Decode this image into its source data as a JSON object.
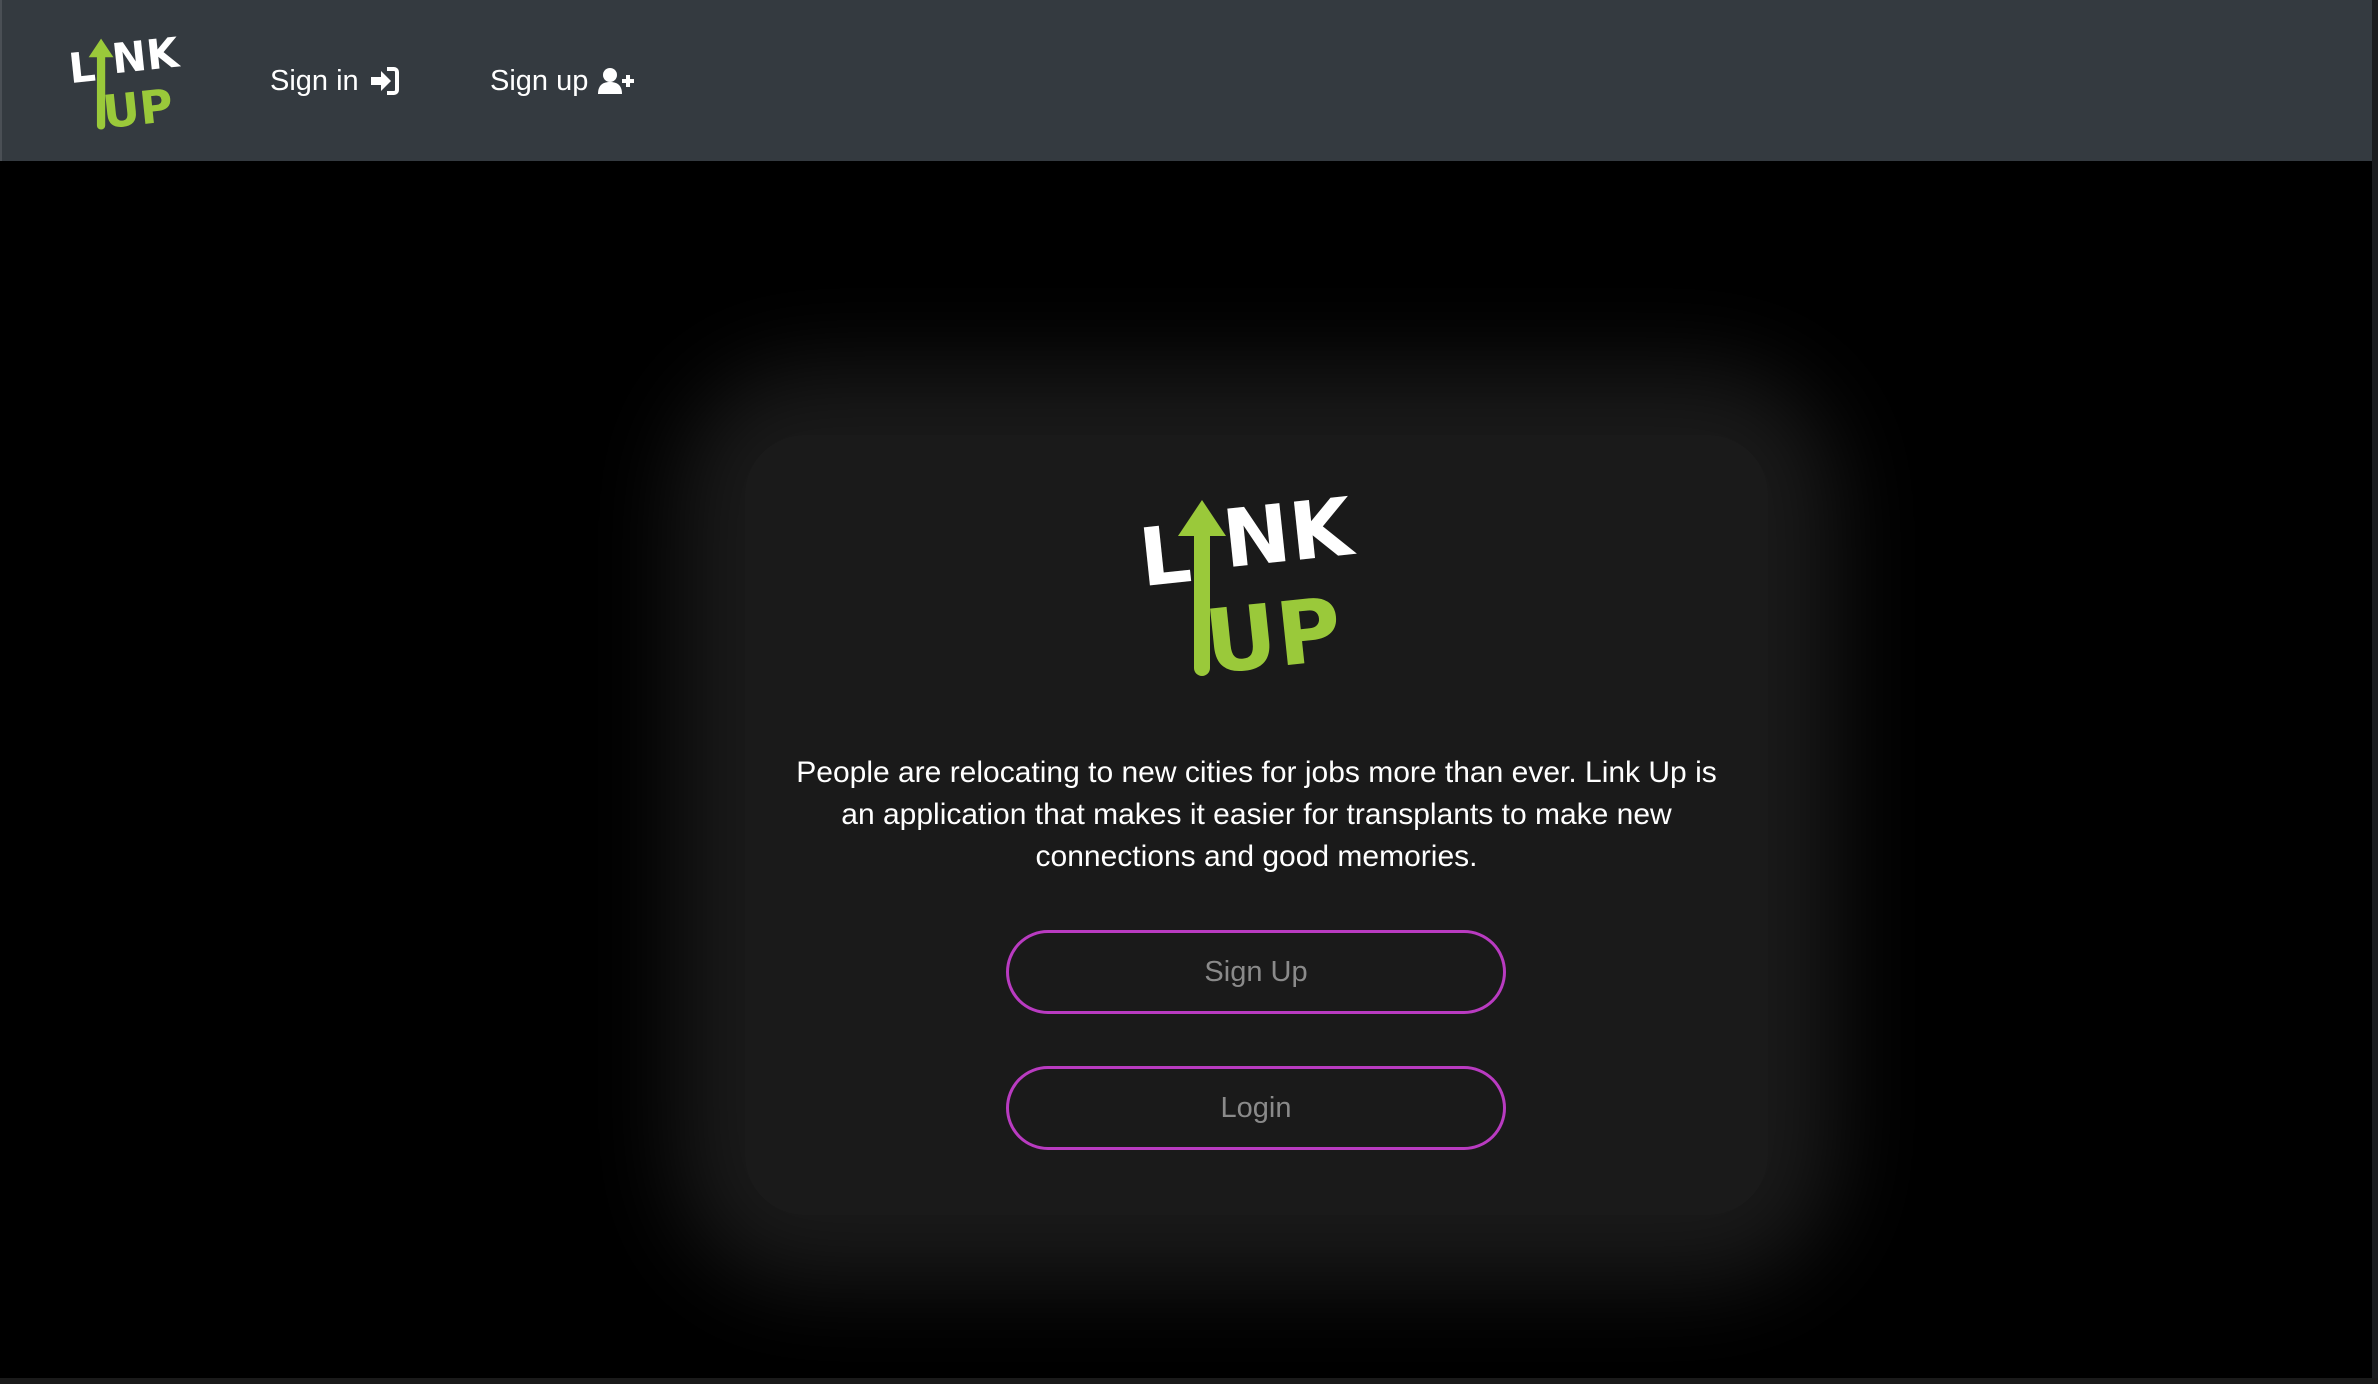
{
  "navbar": {
    "logo": {
      "word_top": "LINK",
      "word_bottom": "UP",
      "colors": {
        "white": "#ffffff",
        "green": "#9ac93a"
      }
    },
    "links": [
      {
        "label": "Sign in",
        "icon": "sign-in-icon"
      },
      {
        "label": "Sign up",
        "icon": "user-plus-icon"
      }
    ],
    "background_color": "#343a40"
  },
  "hero": {
    "logo": {
      "word_top": "LINK",
      "word_bottom": "UP"
    },
    "description": "People are relocating to new cities for jobs more than ever. Link Up is an application that makes it easier for transplants to make new connections and good memories.",
    "buttons": {
      "signup_label": "Sign Up",
      "login_label": "Login"
    },
    "accent_color": "#b93bc1",
    "card_color": "#1a1a1a"
  }
}
